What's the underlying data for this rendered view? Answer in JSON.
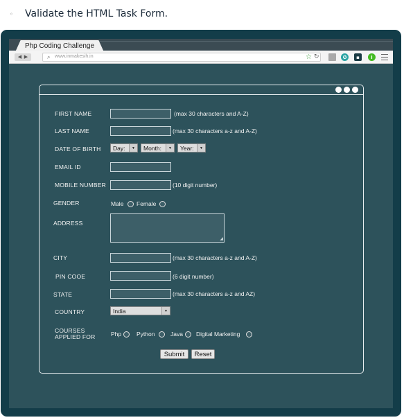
{
  "task": {
    "bullet": "◦",
    "text": "Validate the HTML Task Form."
  },
  "browser": {
    "tab_title": "Php Coding Challenge",
    "url": "www.inmakesih.in",
    "icons": [
      "back-icon",
      "forward-icon",
      "search-icon",
      "star-icon",
      "reload-icon",
      "extension-icon",
      "teal-extension-icon",
      "dark-extension-icon",
      "info-icon",
      "menu-icon"
    ]
  },
  "form": {
    "first_name": {
      "label": "FIRST NAME",
      "hint": "(max 30 characters and A-Z)"
    },
    "last_name": {
      "label": "LAST NAME",
      "hint": "(max 30 characters a-z and A-Z)"
    },
    "dob": {
      "label": "DATE OF BIRTH",
      "day": "Day:",
      "month": "Month:",
      "year": "Year:"
    },
    "email": {
      "label": "EMAIL ID"
    },
    "mobile": {
      "label": "MOBILE NUMBER",
      "hint": "(10 digit number)"
    },
    "gender": {
      "label": "GENDER",
      "options": [
        "Male",
        "Female"
      ]
    },
    "address": {
      "label": "ADDRESS"
    },
    "city": {
      "label": "CITY",
      "hint": "(max 30 characters a-z and A-Z)"
    },
    "pin": {
      "label": "PIN COOE",
      "hint": "(6 digit number)"
    },
    "state": {
      "label": "STATE",
      "hint": "(max 30 characters a-z and AZ)"
    },
    "country": {
      "label": "COUNTRY",
      "value": "India"
    },
    "courses": {
      "label_line1": "COURSES",
      "label_line2": "APPLIED FOR",
      "options": [
        "Php",
        "Python",
        "Java",
        "Digital Marketing"
      ]
    },
    "submit_label": "Submit",
    "reset_label": "Reset"
  }
}
